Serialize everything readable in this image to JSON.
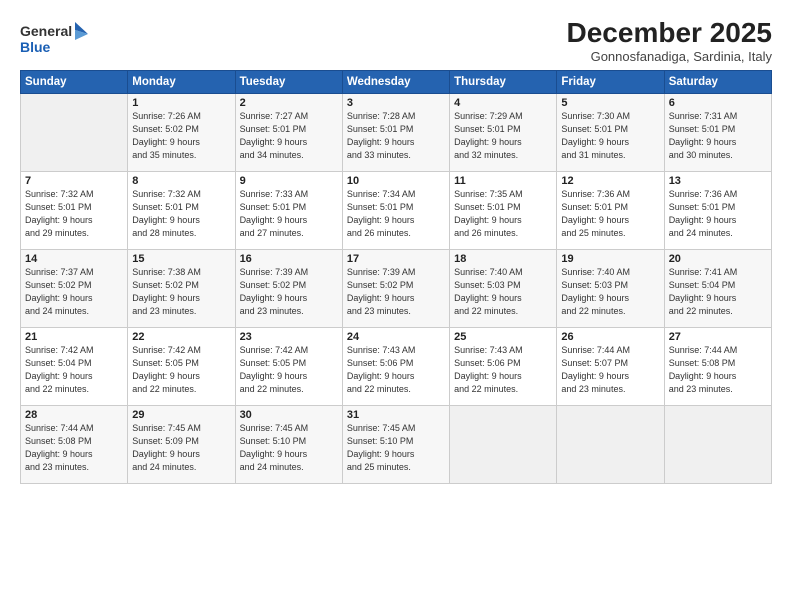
{
  "header": {
    "logo_line1": "General",
    "logo_line2": "Blue",
    "month": "December 2025",
    "location": "Gonnosfanadiga, Sardinia, Italy"
  },
  "weekdays": [
    "Sunday",
    "Monday",
    "Tuesday",
    "Wednesday",
    "Thursday",
    "Friday",
    "Saturday"
  ],
  "weeks": [
    [
      {
        "day": "",
        "info": ""
      },
      {
        "day": "1",
        "info": "Sunrise: 7:26 AM\nSunset: 5:02 PM\nDaylight: 9 hours\nand 35 minutes."
      },
      {
        "day": "2",
        "info": "Sunrise: 7:27 AM\nSunset: 5:01 PM\nDaylight: 9 hours\nand 34 minutes."
      },
      {
        "day": "3",
        "info": "Sunrise: 7:28 AM\nSunset: 5:01 PM\nDaylight: 9 hours\nand 33 minutes."
      },
      {
        "day": "4",
        "info": "Sunrise: 7:29 AM\nSunset: 5:01 PM\nDaylight: 9 hours\nand 32 minutes."
      },
      {
        "day": "5",
        "info": "Sunrise: 7:30 AM\nSunset: 5:01 PM\nDaylight: 9 hours\nand 31 minutes."
      },
      {
        "day": "6",
        "info": "Sunrise: 7:31 AM\nSunset: 5:01 PM\nDaylight: 9 hours\nand 30 minutes."
      }
    ],
    [
      {
        "day": "7",
        "info": "Sunrise: 7:32 AM\nSunset: 5:01 PM\nDaylight: 9 hours\nand 29 minutes."
      },
      {
        "day": "8",
        "info": "Sunrise: 7:32 AM\nSunset: 5:01 PM\nDaylight: 9 hours\nand 28 minutes."
      },
      {
        "day": "9",
        "info": "Sunrise: 7:33 AM\nSunset: 5:01 PM\nDaylight: 9 hours\nand 27 minutes."
      },
      {
        "day": "10",
        "info": "Sunrise: 7:34 AM\nSunset: 5:01 PM\nDaylight: 9 hours\nand 26 minutes."
      },
      {
        "day": "11",
        "info": "Sunrise: 7:35 AM\nSunset: 5:01 PM\nDaylight: 9 hours\nand 26 minutes."
      },
      {
        "day": "12",
        "info": "Sunrise: 7:36 AM\nSunset: 5:01 PM\nDaylight: 9 hours\nand 25 minutes."
      },
      {
        "day": "13",
        "info": "Sunrise: 7:36 AM\nSunset: 5:01 PM\nDaylight: 9 hours\nand 24 minutes."
      }
    ],
    [
      {
        "day": "14",
        "info": "Sunrise: 7:37 AM\nSunset: 5:02 PM\nDaylight: 9 hours\nand 24 minutes."
      },
      {
        "day": "15",
        "info": "Sunrise: 7:38 AM\nSunset: 5:02 PM\nDaylight: 9 hours\nand 23 minutes."
      },
      {
        "day": "16",
        "info": "Sunrise: 7:39 AM\nSunset: 5:02 PM\nDaylight: 9 hours\nand 23 minutes."
      },
      {
        "day": "17",
        "info": "Sunrise: 7:39 AM\nSunset: 5:02 PM\nDaylight: 9 hours\nand 23 minutes."
      },
      {
        "day": "18",
        "info": "Sunrise: 7:40 AM\nSunset: 5:03 PM\nDaylight: 9 hours\nand 22 minutes."
      },
      {
        "day": "19",
        "info": "Sunrise: 7:40 AM\nSunset: 5:03 PM\nDaylight: 9 hours\nand 22 minutes."
      },
      {
        "day": "20",
        "info": "Sunrise: 7:41 AM\nSunset: 5:04 PM\nDaylight: 9 hours\nand 22 minutes."
      }
    ],
    [
      {
        "day": "21",
        "info": "Sunrise: 7:42 AM\nSunset: 5:04 PM\nDaylight: 9 hours\nand 22 minutes."
      },
      {
        "day": "22",
        "info": "Sunrise: 7:42 AM\nSunset: 5:05 PM\nDaylight: 9 hours\nand 22 minutes."
      },
      {
        "day": "23",
        "info": "Sunrise: 7:42 AM\nSunset: 5:05 PM\nDaylight: 9 hours\nand 22 minutes."
      },
      {
        "day": "24",
        "info": "Sunrise: 7:43 AM\nSunset: 5:06 PM\nDaylight: 9 hours\nand 22 minutes."
      },
      {
        "day": "25",
        "info": "Sunrise: 7:43 AM\nSunset: 5:06 PM\nDaylight: 9 hours\nand 22 minutes."
      },
      {
        "day": "26",
        "info": "Sunrise: 7:44 AM\nSunset: 5:07 PM\nDaylight: 9 hours\nand 23 minutes."
      },
      {
        "day": "27",
        "info": "Sunrise: 7:44 AM\nSunset: 5:08 PM\nDaylight: 9 hours\nand 23 minutes."
      }
    ],
    [
      {
        "day": "28",
        "info": "Sunrise: 7:44 AM\nSunset: 5:08 PM\nDaylight: 9 hours\nand 23 minutes."
      },
      {
        "day": "29",
        "info": "Sunrise: 7:45 AM\nSunset: 5:09 PM\nDaylight: 9 hours\nand 24 minutes."
      },
      {
        "day": "30",
        "info": "Sunrise: 7:45 AM\nSunset: 5:10 PM\nDaylight: 9 hours\nand 24 minutes."
      },
      {
        "day": "31",
        "info": "Sunrise: 7:45 AM\nSunset: 5:10 PM\nDaylight: 9 hours\nand 25 minutes."
      },
      {
        "day": "",
        "info": ""
      },
      {
        "day": "",
        "info": ""
      },
      {
        "day": "",
        "info": ""
      }
    ]
  ]
}
